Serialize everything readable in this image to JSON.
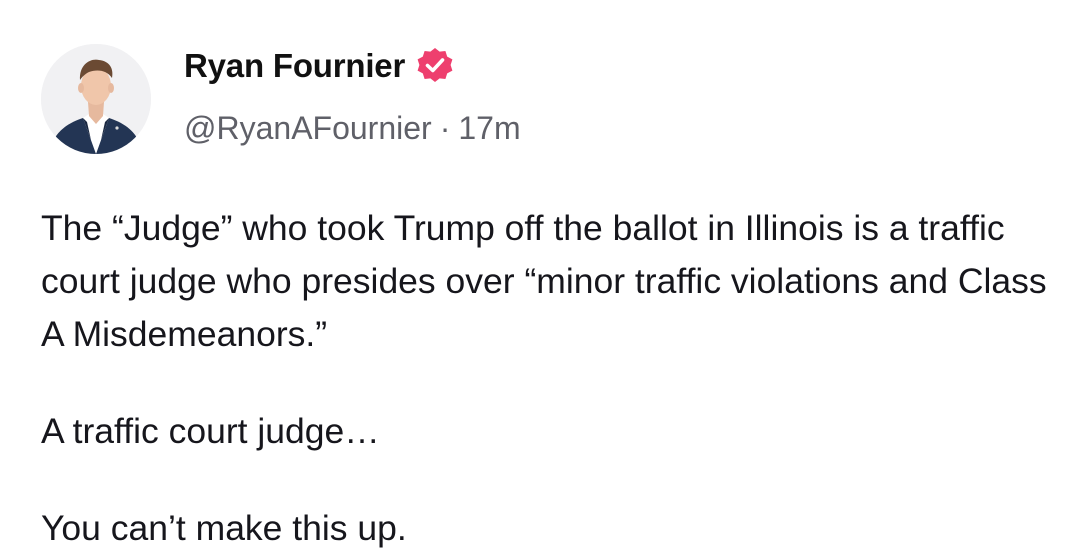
{
  "post": {
    "author": {
      "name": "Ryan Fournier",
      "handle": "@RyanAFournier",
      "verified": true,
      "verified_icon": "verified-badge-icon",
      "verified_color": "#ee3f6e",
      "avatar_icon": "profile-photo"
    },
    "separator": "·",
    "time_ago": "17m",
    "paragraphs": [
      "The “Judge” who took Trump off the ballot in Illinois is a traffic court judge who presides over “minor traffic violations and Class A Misdemeanors.”",
      "A traffic court judge…",
      "You can’t make this up."
    ]
  }
}
